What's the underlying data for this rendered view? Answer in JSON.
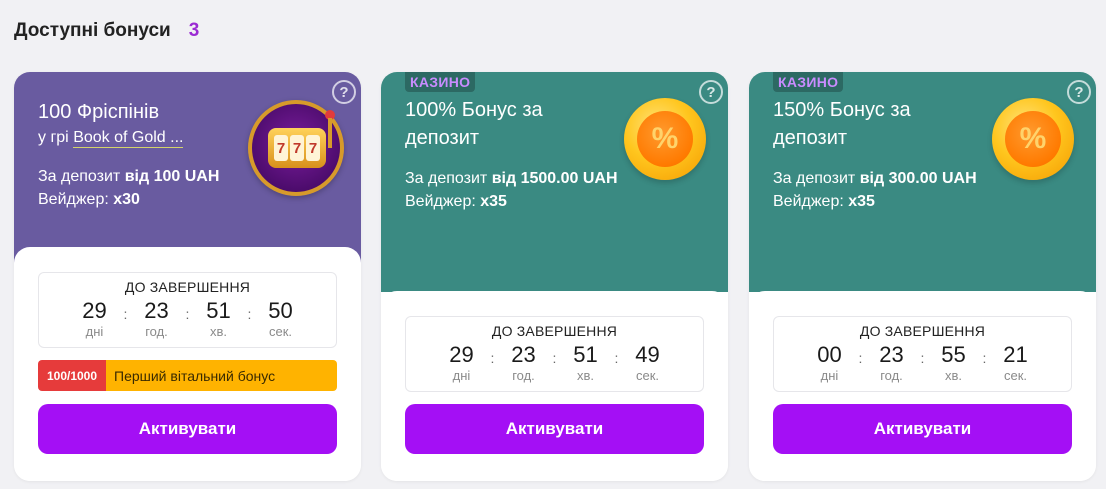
{
  "header": {
    "title": "Доступні бонуси",
    "count": "3"
  },
  "colors": {
    "purple_card": "#695ba0",
    "teal_card": "#3a8a82",
    "button": "#a40ff5",
    "count": "#9b2bd3",
    "progress_count": "#e63b3b",
    "progress_text": "#ffb300"
  },
  "cards": [
    {
      "title": "100 Фріспінів",
      "game_prefix": "у грі",
      "game_name": "Book of Gold ...",
      "deposit_prefix": "За депозит",
      "deposit_value": "від 100 UAH",
      "wager_label": "Вейджер:",
      "wager_value": "x30",
      "help": "?",
      "icon": "slot-machine-icon",
      "timer": {
        "label": "ДО ЗАВЕРШЕННЯ",
        "days": "29",
        "days_label": "дні",
        "hours": "23",
        "hours_label": "год.",
        "minutes": "51",
        "minutes_label": "хв.",
        "seconds": "50",
        "seconds_label": "сек."
      },
      "progress": {
        "count": "100/1000",
        "text": "Перший вітальний бонус"
      },
      "button": "Активувати"
    },
    {
      "tag": "КАЗИНО",
      "title_line1": "100% Бонус за",
      "title_line2": "депозит",
      "deposit_prefix": "За депозит",
      "deposit_value": "від 1500.00 UAH",
      "wager_label": "Вейджер:",
      "wager_value": "x35",
      "help": "?",
      "icon": "percent-coin-icon",
      "coin_symbol": "%",
      "timer": {
        "label": "ДО ЗАВЕРШЕННЯ",
        "days": "29",
        "days_label": "дні",
        "hours": "23",
        "hours_label": "год.",
        "minutes": "51",
        "minutes_label": "хв.",
        "seconds": "49",
        "seconds_label": "сек."
      },
      "button": "Активувати"
    },
    {
      "tag": "КАЗИНО",
      "title_line1": "150% Бонус за",
      "title_line2": "депозит",
      "deposit_prefix": "За депозит",
      "deposit_value": "від 300.00 UAH",
      "wager_label": "Вейджер:",
      "wager_value": "x35",
      "help": "?",
      "icon": "percent-coin-icon",
      "coin_symbol": "%",
      "timer": {
        "label": "ДО ЗАВЕРШЕННЯ",
        "days": "00",
        "days_label": "дні",
        "hours": "23",
        "hours_label": "год.",
        "minutes": "55",
        "minutes_label": "хв.",
        "seconds": "21",
        "seconds_label": "сек."
      },
      "button": "Активувати"
    }
  ]
}
